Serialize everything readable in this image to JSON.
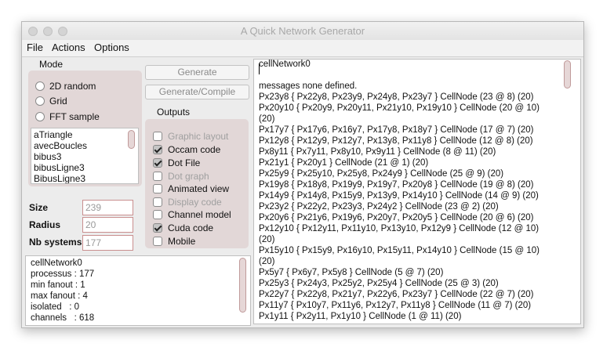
{
  "window": {
    "title": "A Quick Network Generator"
  },
  "menu": [
    "File",
    "Actions",
    "Options"
  ],
  "mode": {
    "label": "Mode",
    "options": [
      "2D random",
      "Grid",
      "FFT sample"
    ]
  },
  "samples": [
    "aTriangle",
    "avecBoucles",
    "bibus3",
    "bibusLigne3",
    "BibusLigne3"
  ],
  "buttons": {
    "generate": "Generate",
    "generate_compile": "Generate/Compile"
  },
  "outputs": {
    "label": "Outputs",
    "items": [
      {
        "label": "Graphic layout",
        "checked": false,
        "enabled": false
      },
      {
        "label": "Occam code",
        "checked": true,
        "enabled": true
      },
      {
        "label": "Dot File",
        "checked": true,
        "enabled": true
      },
      {
        "label": "Dot graph",
        "checked": false,
        "enabled": false
      },
      {
        "label": "Animated view",
        "checked": false,
        "enabled": true
      },
      {
        "label": "Display code",
        "checked": false,
        "enabled": false
      },
      {
        "label": "Channel model",
        "checked": false,
        "enabled": true
      },
      {
        "label": "Cuda code",
        "checked": true,
        "enabled": true
      },
      {
        "label": "Mobile",
        "checked": false,
        "enabled": true
      }
    ]
  },
  "params": {
    "size_label": "Size",
    "size_value": "239",
    "radius_label": "Radius",
    "radius_value": "20",
    "nb_label": "Nb systems",
    "nb_value": "177"
  },
  "stats": [
    "cellNetwork0",
    "processus : 177",
    "min fanout : 1",
    "max fanout : 4",
    "isolated   : 0",
    "channels   : 618"
  ],
  "output_text": {
    "title": "cellNetwork0",
    "lines": [
      "messages none  defined.",
      "Px23y8 { Px22y8, Px23y9, Px24y8, Px23y7 } CellNode (23 @ 8) (20)",
      "Px20y10 { Px20y9, Px20y11, Px21y10, Px19y10 } CellNode (20 @ 10)",
      "(20)",
      "Px17y7 { Px17y6, Px16y7, Px17y8, Px18y7 } CellNode (17 @ 7) (20)",
      "Px12y8 { Px12y9, Px12y7, Px13y8, Px11y8 } CellNode (12 @ 8) (20)",
      "Px8y11 { Px7y11, Px8y10, Px9y11 } CellNode (8 @ 11) (20)",
      "Px21y1 { Px20y1 } CellNode (21 @ 1) (20)",
      "Px25y9 { Px25y10, Px25y8, Px24y9 } CellNode (25 @ 9) (20)",
      "Px19y8 { Px18y8, Px19y9, Px19y7, Px20y8 } CellNode (19 @ 8) (20)",
      "Px14y9 { Px14y8, Px15y9, Px13y9, Px14y10 } CellNode (14 @ 9) (20)",
      "Px23y2 { Px22y2, Px23y3, Px24y2 } CellNode (23 @ 2) (20)",
      "Px20y6 { Px21y6, Px19y6, Px20y7, Px20y5 } CellNode (20 @ 6) (20)",
      "Px12y10 { Px12y11, Px11y10, Px13y10, Px12y9 } CellNode (12 @ 10)",
      "(20)",
      "Px15y10 { Px15y9, Px16y10, Px15y11, Px14y10 } CellNode (15 @ 10)",
      "(20)",
      "Px5y7 { Px6y7, Px5y8 } CellNode (5 @ 7) (20)",
      "Px25y3 { Px24y3, Px25y2, Px25y4 } CellNode (25 @ 3) (20)",
      "Px22y7 { Px22y8, Px21y7, Px22y6, Px23y7 } CellNode (22 @ 7) (20)",
      "Px11y7 { Px10y7, Px11y6, Px12y7, Px11y8 } CellNode (11 @ 7) (20)",
      "Px1y11 { Px2y11, Px1y10 } CellNode (1 @ 11) (20)"
    ]
  }
}
